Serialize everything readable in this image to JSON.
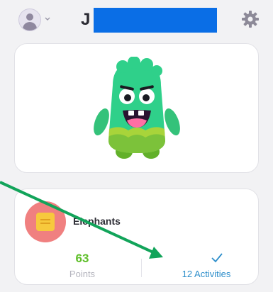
{
  "header": {
    "name_initial": "J",
    "profile_icon": "user-icon",
    "settings_icon": "gear-icon"
  },
  "class_card": {
    "name": "Elephants",
    "points_value": "63",
    "points_label": "Points",
    "activities_label": "12 Activities",
    "check_icon": "check-icon"
  },
  "colors": {
    "points": "#5fbf2a",
    "activities": "#2f8fcb",
    "redaction": "#0a6ee6",
    "annotation_arrow": "#12a45a"
  }
}
